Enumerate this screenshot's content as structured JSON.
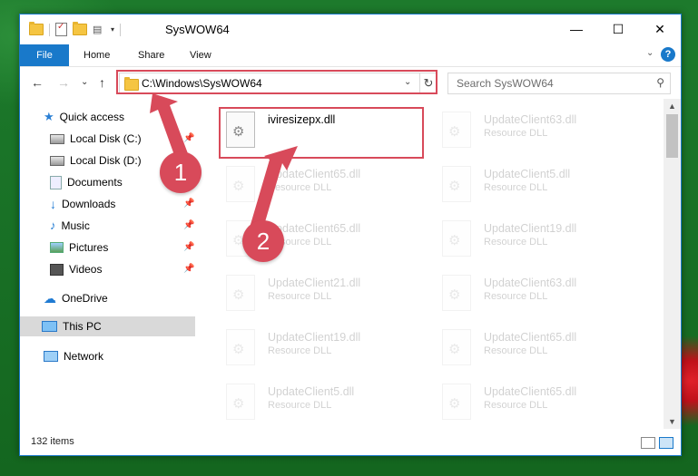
{
  "window": {
    "title": "SysWOW64",
    "controls": {
      "minimize": "—",
      "maximize": "☐",
      "close": "✕"
    }
  },
  "ribbon": {
    "tabs": [
      {
        "label": "File"
      },
      {
        "label": "Home"
      },
      {
        "label": "Share"
      },
      {
        "label": "View"
      }
    ],
    "help": "?"
  },
  "navbar": {
    "back": "←",
    "forward": "→",
    "recent": "⌄",
    "up": "↑",
    "address": "C:\\Windows\\SysWOW64",
    "search_placeholder": "Search SysWOW64"
  },
  "sidebar": {
    "items": [
      {
        "label": "Quick access",
        "icon": "star-icon"
      },
      {
        "label": "Local Disk (C:)",
        "icon": "drive-icon",
        "pinned": true
      },
      {
        "label": "Local Disk (D:)",
        "icon": "drive-icon",
        "pinned": false
      },
      {
        "label": "Documents",
        "icon": "documents-icon",
        "pinned": true
      },
      {
        "label": "Downloads",
        "icon": "download-icon",
        "pinned": true
      },
      {
        "label": "Music",
        "icon": "music-icon",
        "pinned": true
      },
      {
        "label": "Pictures",
        "icon": "pictures-icon",
        "pinned": true
      },
      {
        "label": "Videos",
        "icon": "video-icon",
        "pinned": true
      },
      {
        "label": "OneDrive",
        "icon": "cloud-icon"
      },
      {
        "label": "This PC",
        "icon": "computer-icon",
        "selected": true
      },
      {
        "label": "Network",
        "icon": "network-icon"
      }
    ]
  },
  "files": [
    {
      "name": "iviresizepx.dll",
      "type": "",
      "faded": false
    },
    {
      "name": "UpdateClient63.dll",
      "type": "Resource DLL",
      "faded": true
    },
    {
      "name": "UpdateClient65.dll",
      "type": "Resource DLL",
      "faded": true
    },
    {
      "name": "UpdateClient5.dll",
      "type": "Resource DLL",
      "faded": true
    },
    {
      "name": "UpdateClient65.dll",
      "type": "Resource DLL",
      "faded": true
    },
    {
      "name": "UpdateClient19.dll",
      "type": "Resource DLL",
      "faded": true
    },
    {
      "name": "UpdateClient21.dll",
      "type": "Resource DLL",
      "faded": true
    },
    {
      "name": "UpdateClient63.dll",
      "type": "Resource DLL",
      "faded": true
    },
    {
      "name": "UpdateClient19.dll",
      "type": "Resource DLL",
      "faded": true
    },
    {
      "name": "UpdateClient65.dll",
      "type": "Resource DLL",
      "faded": true
    },
    {
      "name": "UpdateClient5.dll",
      "type": "Resource DLL",
      "faded": true
    },
    {
      "name": "UpdateClient65.dll",
      "type": "Resource DLL",
      "faded": true
    }
  ],
  "status": {
    "item_count": "132 items"
  },
  "annotations": {
    "step1": "1",
    "step2": "2",
    "color": "#d84a5a"
  }
}
